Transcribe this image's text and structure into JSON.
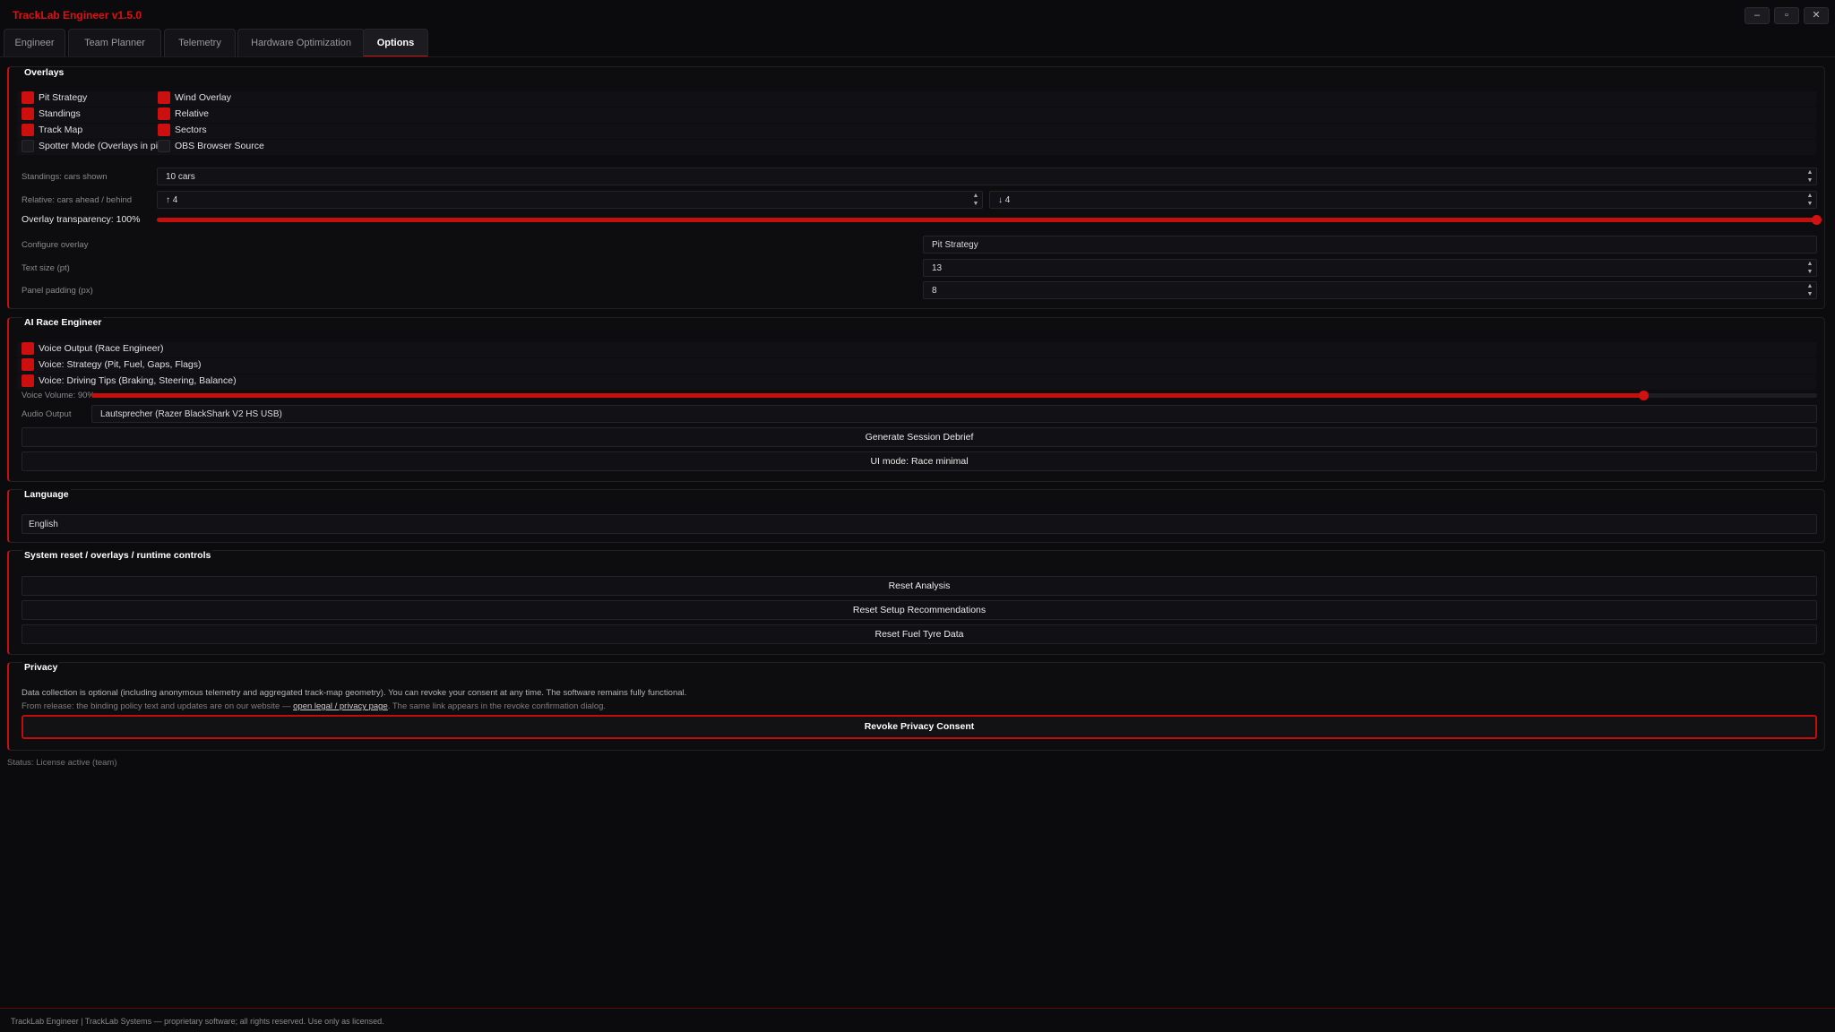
{
  "app": {
    "title": "TrackLab Engineer v1.5.0"
  },
  "window_controls": {
    "minimize": "–",
    "maximize": "▫",
    "close": "✕"
  },
  "tabs": [
    {
      "label": "Engineer"
    },
    {
      "label": "Team Planner"
    },
    {
      "label": "Telemetry"
    },
    {
      "label": "Hardware Optimization"
    },
    {
      "label": "Options"
    }
  ],
  "overlays": {
    "title": "Overlays",
    "checkboxes": [
      {
        "label": "Pit Strategy",
        "checked": true
      },
      {
        "label": "Wind Overlay",
        "checked": true
      },
      {
        "label": "Standings",
        "checked": true
      },
      {
        "label": "Relative",
        "checked": true
      },
      {
        "label": "Track Map",
        "checked": true
      },
      {
        "label": "Sectors",
        "checked": true
      },
      {
        "label": "Spotter Mode (Overlays in pit)",
        "checked": false
      },
      {
        "label": "OBS Browser Source",
        "checked": false
      }
    ],
    "standings_label": "Standings: cars shown",
    "standings_value": "10 cars",
    "relative_label": "Relative: cars ahead / behind",
    "relative_ahead": "↑ 4",
    "relative_behind": "↓ 4",
    "transparency_label": "Overlay transparency: 100%",
    "transparency_percent": 100,
    "configure_label": "Configure overlay",
    "configure_value": "Pit Strategy",
    "text_size_label": "Text size (pt)",
    "text_size_value": "13",
    "padding_label": "Panel padding (px)",
    "padding_value": "8"
  },
  "ai_engineer": {
    "title": "AI Race Engineer",
    "checkboxes": [
      {
        "label": "Voice Output (Race Engineer)",
        "checked": true
      },
      {
        "label": "Voice: Strategy (Pit, Fuel, Gaps, Flags)",
        "checked": true
      },
      {
        "label": "Voice: Driving Tips (Braking, Steering, Balance)",
        "checked": true
      }
    ],
    "volume_label": "Voice Volume: 90%",
    "volume_percent": 90,
    "audio_label": "Audio Output",
    "audio_value": "Lautsprecher (Razer BlackShark V2 HS USB)",
    "debrief_button": "Generate Session Debrief",
    "ui_mode_button": "UI mode: Race minimal"
  },
  "language": {
    "title": "Language",
    "value": "English"
  },
  "system": {
    "title": "System reset / overlays / runtime controls",
    "reset_analysis": "Reset Analysis",
    "reset_setup": "Reset Setup Recommendations",
    "reset_fuel": "Reset Fuel  Tyre Data"
  },
  "privacy": {
    "title": "Privacy",
    "text1": "Data collection is optional (including anonymous telemetry and aggregated track-map geometry). You can revoke your consent at any time. The software remains fully functional.",
    "text2_before": "From release: the binding policy text and updates are on our website — ",
    "text2_link": "open legal / privacy page",
    "text2_after": ". The same link appears in the revoke confirmation dialog.",
    "revoke_button": "Revoke Privacy Consent"
  },
  "status": "Status: License active (team)",
  "footer": "TrackLab Engineer | TrackLab Systems — proprietary software; all rights reserved. Use only as licensed.",
  "colors": {
    "accent": "#cc0f0f",
    "background": "#0b0b0e",
    "panel": "#0d0d10"
  }
}
